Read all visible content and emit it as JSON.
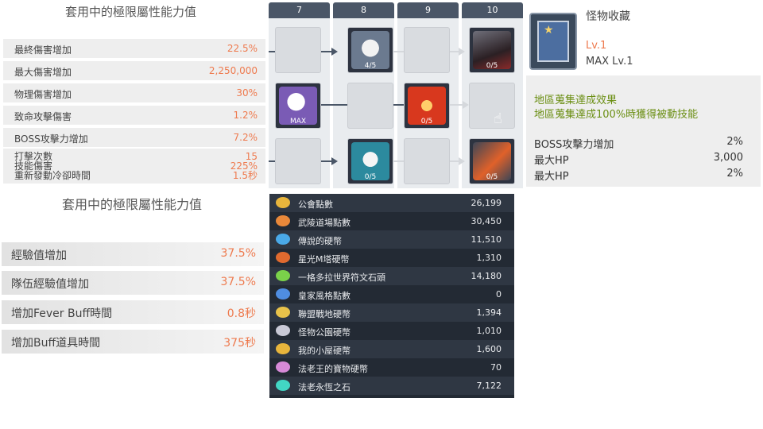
{
  "panel1": {
    "title": "套用中的極限屬性能力值",
    "rows": [
      {
        "label": "最終傷害增加",
        "value": "22.5%"
      },
      {
        "label": "最大傷害增加",
        "value": "2,250,000"
      },
      {
        "label": "物理傷害增加",
        "value": "30%"
      },
      {
        "label": "致命攻擊傷害",
        "value": "1.2%"
      },
      {
        "label": "BOSS攻擊力增加",
        "value": "7.2%"
      }
    ],
    "multi": {
      "labels": [
        "打擊次數",
        "技能傷害",
        "重新發動冷卻時間"
      ],
      "values": [
        "15",
        "225%",
        "1.5秒"
      ]
    }
  },
  "panel2": {
    "title": "套用中的極限屬性能力值",
    "rows": [
      {
        "label": "經驗值增加",
        "value": "37.5%"
      },
      {
        "label": "隊伍經驗值增加",
        "value": "37.5%"
      },
      {
        "label": "增加Fever Buff時間",
        "value": "0.8秒"
      },
      {
        "label": "增加Buff道具時間",
        "value": "375秒"
      }
    ]
  },
  "grid": {
    "columns": [
      "7",
      "8",
      "9",
      "10"
    ],
    "cells": [
      {
        "count": "4/5"
      },
      {
        "count": "0/5"
      },
      {
        "count": "MAX"
      },
      {
        "count": "0/5"
      },
      {
        "count": "0/5"
      },
      {
        "count": "0/5"
      }
    ]
  },
  "card": {
    "name": "怪物收藏",
    "level": "Lv.1",
    "max_level": "MAX Lv.1"
  },
  "effects": {
    "line1": "地區蒐集達成效果",
    "line2": "地區蒐集達成100%時獲得被動技能",
    "stats": [
      {
        "label": "BOSS攻擊力增加",
        "value": "2%"
      },
      {
        "label": "最大HP",
        "value": "3,000"
      },
      {
        "label": "最大HP",
        "value": "2%"
      }
    ]
  },
  "currencies": [
    {
      "label": "公會點數",
      "value": "26,199",
      "icon_color": "#e8b53c"
    },
    {
      "label": "武陵道場點數",
      "value": "30,450",
      "icon_color": "#e8883a"
    },
    {
      "label": "傳說的硬幣",
      "value": "11,510",
      "icon_color": "#4aa9e8"
    },
    {
      "label": "星光M塔硬幣",
      "value": "1,310",
      "icon_color": "#e06a2f"
    },
    {
      "label": "一格多拉世界符文石頭",
      "value": "14,180",
      "icon_color": "#7ad14a"
    },
    {
      "label": "皇家風格點數",
      "value": "0",
      "icon_color": "#4f8de0"
    },
    {
      "label": "聯盟戰地硬幣",
      "value": "1,394",
      "icon_color": "#e8c24a"
    },
    {
      "label": "怪物公園硬幣",
      "value": "1,010",
      "icon_color": "#c9c9d6"
    },
    {
      "label": "我的小屋硬幣",
      "value": "1,600",
      "icon_color": "#e8b53c"
    },
    {
      "label": "法老王的寶物硬幣",
      "value": "70",
      "icon_color": "#d78ad8"
    },
    {
      "label": "法老永恆之石",
      "value": "7,122",
      "icon_color": "#42d6c4"
    }
  ]
}
